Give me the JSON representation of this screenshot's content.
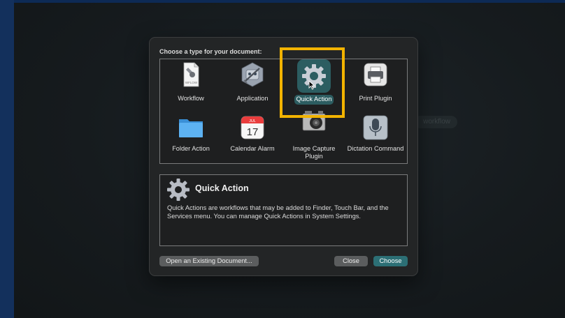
{
  "background": {
    "faint_pill_text": "workflow"
  },
  "dialog": {
    "prompt": "Choose a type for your document:",
    "types": [
      {
        "label": "Workflow",
        "icon": "workflow-document-icon",
        "badge": "WFLOW"
      },
      {
        "label": "Application",
        "icon": "automator-robot-icon"
      },
      {
        "label": "Quick Action",
        "icon": "gear-icon",
        "selected": true
      },
      {
        "label": "Print Plugin",
        "icon": "printer-icon"
      },
      {
        "label": "Folder Action",
        "icon": "folder-icon"
      },
      {
        "label": "Calendar Alarm",
        "icon": "calendar-icon",
        "month": "JUL",
        "day": "17"
      },
      {
        "label": "Image Capture Plugin",
        "icon": "camera-icon"
      },
      {
        "label": "Dictation Command",
        "icon": "microphone-icon"
      }
    ],
    "description": {
      "title": "Quick Action",
      "text": "Quick Actions are workflows that may be added to Finder, Touch Bar, and the Services menu. You can manage Quick Actions in System Settings."
    },
    "buttons": {
      "open_existing": "Open an Existing Document...",
      "close": "Close",
      "choose": "Choose"
    }
  },
  "colors": {
    "selection": "#2c5d61",
    "highlight_box": "#f2b300",
    "choose_button": "#2c6f75"
  }
}
